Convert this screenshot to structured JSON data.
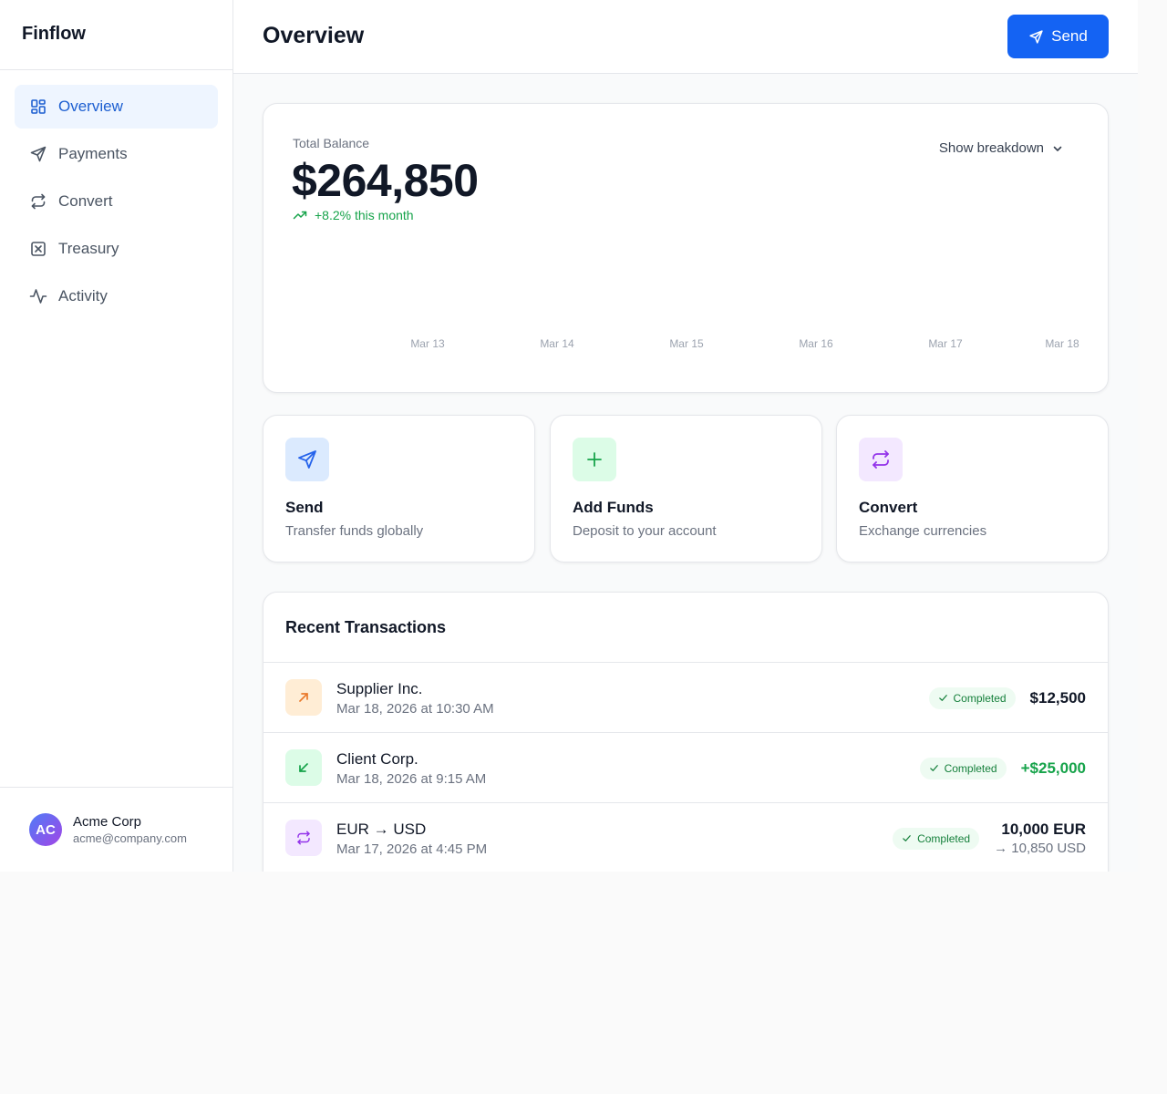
{
  "app": {
    "name": "Finflow"
  },
  "sidebar": {
    "items": [
      {
        "label": "Overview",
        "icon": "dashboard-icon",
        "active": true
      },
      {
        "label": "Payments",
        "icon": "send-icon"
      },
      {
        "label": "Convert",
        "icon": "exchange-icon"
      },
      {
        "label": "Treasury",
        "icon": "treasury-icon"
      },
      {
        "label": "Activity",
        "icon": "activity-icon"
      }
    ],
    "user": {
      "initials": "AC",
      "name": "Acme Corp",
      "email": "acme@company.com"
    }
  },
  "header": {
    "title": "Overview",
    "send_label": "Send"
  },
  "balance": {
    "label": "Total Balance",
    "amount": "$264,850",
    "change": "+8.2% this month",
    "breakdown_label": "Show breakdown",
    "dates": [
      "Mar 13",
      "Mar 14",
      "Mar 15",
      "Mar 16",
      "Mar 17",
      "Mar 18"
    ]
  },
  "actions": [
    {
      "title": "Send",
      "subtitle": "Transfer funds globally",
      "icon": "send-icon",
      "bg": "#dbeafe",
      "color": "#2563eb"
    },
    {
      "title": "Add Funds",
      "subtitle": "Deposit to your account",
      "icon": "plus-icon",
      "bg": "#dcfce7",
      "color": "#16a34a"
    },
    {
      "title": "Convert",
      "subtitle": "Exchange currencies",
      "icon": "exchange-icon",
      "bg": "#f3e8ff",
      "color": "#9333ea"
    }
  ],
  "transactions": {
    "title": "Recent Transactions",
    "rows": [
      {
        "name": "Supplier Inc.",
        "date": "Mar 18, 2026 at 10:30 AM",
        "status": "Completed",
        "amount": "$12,500",
        "sub": "",
        "direction": "outgoing",
        "icon": "arrow-up-right-icon"
      },
      {
        "name": "Client Corp.",
        "date": "Mar 18, 2026 at 9:15 AM",
        "status": "Completed",
        "amount": "+$25,000",
        "sub": "",
        "direction": "incoming",
        "icon": "arrow-down-left-icon"
      },
      {
        "name": "EUR → USD",
        "date": "Mar 17, 2026 at 4:45 PM",
        "status": "Completed",
        "amount": "10,000 EUR",
        "sub": "→ 10,850 USD",
        "direction": "conversion",
        "icon": "exchange-icon"
      }
    ]
  },
  "colors": {
    "primary": "#1463f3",
    "success": "#16a34a",
    "outgoing_bg": "#ffedd5",
    "outgoing_fg": "#ea7a2c",
    "incoming_bg": "#dcfce7",
    "incoming_fg": "#16a34a",
    "conversion_bg": "#f3e8ff",
    "conversion_fg": "#9333ea"
  }
}
